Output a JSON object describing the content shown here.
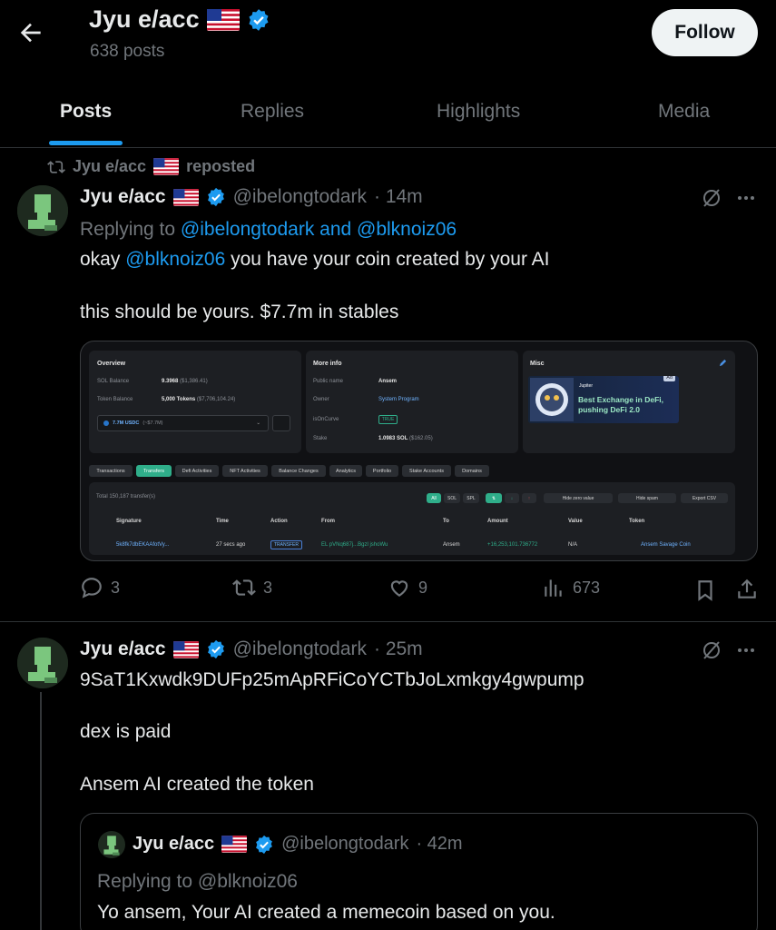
{
  "header": {
    "display_name": "Jyu e/acc",
    "post_count": "638 posts",
    "follow_label": "Follow"
  },
  "tabs": [
    "Posts",
    "Replies",
    "Highlights",
    "Media"
  ],
  "colors": {
    "accent": "#1d9bf0",
    "background": "#000000",
    "muted": "#71767b"
  },
  "repost_banner": {
    "text": "Jyu e/acc",
    "suffix": "reposted"
  },
  "tweet1": {
    "name": "Jyu e/acc",
    "handle": "@ibelongtodark",
    "time": "· 14m",
    "replying_prefix": "Replying to",
    "replying_targets": "@ibelongtodark and @blknoiz06",
    "line1_pre": "okay",
    "line1_mention": "@blknoiz06",
    "line1_post": "you have your coin created by your AI",
    "line2": "this should be yours. $7.7m in stables",
    "stats": {
      "replies": "3",
      "reposts": "3",
      "likes": "9",
      "views": "673"
    }
  },
  "media": {
    "overview": {
      "title": "Overview",
      "sol_label": "SOL Balance",
      "sol_value": "9.3968",
      "sol_usd": "($1,386.41)",
      "token_label": "Token Balance",
      "token_value": "5,000 Tokens",
      "token_usd": "($7,706,104.24)",
      "select": "7.7M USDC",
      "select_sub": "(~$7.7M)"
    },
    "moreinfo": {
      "title": "More info",
      "public_name_label": "Public name",
      "public_name": "Ansem",
      "owner_label": "Owner",
      "owner": "System Program",
      "curve_label": "isOnCurve",
      "curve": "TRUE",
      "stake_label": "Stake",
      "stake": "1.0983 SOL",
      "stake_usd": "($162.05)"
    },
    "misc": {
      "title": "Misc",
      "ad_badge": "Ad",
      "ad_brand": "Jupiter",
      "ad_line1": "Best Exchange in DeFi,",
      "ad_line2": "pushing DeFi 2.0"
    },
    "nav_tabs": [
      "Transactions",
      "Transfers",
      "Defi Activities",
      "NFT Activities",
      "Balance Changes",
      "Analytics",
      "Portfolio",
      "Stake Accounts",
      "Domains"
    ],
    "total": "Total 150,187 transfer(s)",
    "filters": [
      "All",
      "SOL",
      "SPL"
    ],
    "hide_zero": "Hide zero value",
    "hide_spam": "Hide spam",
    "export": "Export CSV",
    "columns": [
      "Signature",
      "Time",
      "Action",
      "From",
      "To",
      "Amount",
      "Value",
      "Token"
    ],
    "row": {
      "signature": "5k8fk7dbEKAAfotVy...",
      "time": "27 secs ago",
      "action": "TRANSFER",
      "from": "EL pVNq687j...Bgzl jshoWu",
      "to": "Ansem",
      "amount": "+16,253,101.736772",
      "value": "N/A",
      "token": "Ansem Savage Coin"
    }
  },
  "tweet2": {
    "name": "Jyu e/acc",
    "handle": "@ibelongtodark",
    "time": "· 25m",
    "line1": "9SaT1Kxwdk9DUFp25mApRFiCoYCTbJoLxmkgy4gwpump",
    "line2": "dex is paid",
    "line3": "Ansem AI created the token"
  },
  "quoted": {
    "name": "Jyu e/acc",
    "handle": "@ibelongtodark",
    "time": "· 42m",
    "replying": "Replying to @blknoiz06",
    "text": "Yo ansem, Your AI created a memecoin based on you."
  }
}
